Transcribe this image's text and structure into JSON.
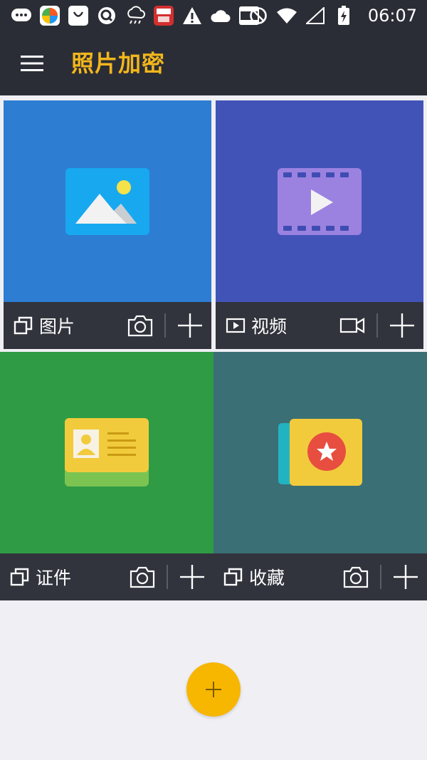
{
  "status_bar": {
    "time": "06:07",
    "icons": [
      "chat-icon",
      "pinwheel-icon",
      "shopping-bag-icon",
      "q-icon",
      "weather-icon",
      "news-red-icon",
      "warning-icon",
      "cloud-icon",
      "toutiao-icon",
      "dnd-icon",
      "wifi-icon",
      "signal-icon",
      "battery-charging-icon"
    ],
    "badge_red_text": "综合",
    "badge_toutiao_text": "头条"
  },
  "app_bar": {
    "title": "照片加密",
    "title_color": "#F3B71C",
    "menu_icon": "hamburger-menu-icon"
  },
  "tiles": [
    {
      "id": "photos",
      "label": "图片",
      "color": "#2D7DD2",
      "label_icon": "stack-icon",
      "action1_icon": "camera-icon",
      "action2_icon": "plus-icon"
    },
    {
      "id": "videos",
      "label": "视频",
      "color": "#4253B8",
      "label_icon": "play-box-icon",
      "action1_icon": "video-camera-icon",
      "action2_icon": "plus-icon"
    },
    {
      "id": "documents",
      "label": "证件",
      "color": "#2F9B44",
      "label_icon": "stack-icon",
      "action1_icon": "camera-icon",
      "action2_icon": "plus-icon"
    },
    {
      "id": "favorites",
      "label": "收藏",
      "color": "#3A6F75",
      "label_icon": "stack-icon",
      "action1_icon": "camera-icon",
      "action2_icon": "plus-icon"
    }
  ],
  "fab": {
    "icon": "plus-icon",
    "color": "#F7B600"
  }
}
